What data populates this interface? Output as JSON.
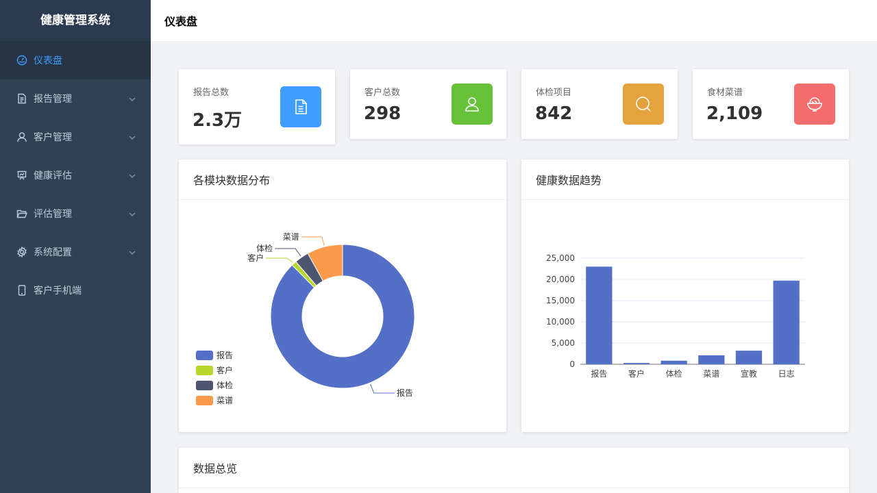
{
  "app": {
    "title": "健康管理系统"
  },
  "header": {
    "title": "仪表盘"
  },
  "sidebar": {
    "items": [
      {
        "label": "仪表盘",
        "icon": "dashboard-icon",
        "active": true,
        "expandable": false
      },
      {
        "label": "报告管理",
        "icon": "document-icon",
        "active": false,
        "expandable": true
      },
      {
        "label": "客户管理",
        "icon": "user-icon",
        "active": false,
        "expandable": true
      },
      {
        "label": "健康评估",
        "icon": "presentation-icon",
        "active": false,
        "expandable": true
      },
      {
        "label": "评估管理",
        "icon": "folder-open-icon",
        "active": false,
        "expandable": true
      },
      {
        "label": "系统配置",
        "icon": "gear-icon",
        "active": false,
        "expandable": true
      },
      {
        "label": "客户手机端",
        "icon": "mobile-icon",
        "active": false,
        "expandable": false
      }
    ]
  },
  "stats": [
    {
      "label": "报告总数",
      "value": "2.3万",
      "icon": "document-icon",
      "color": "#409eff"
    },
    {
      "label": "客户总数",
      "value": "298",
      "icon": "user-icon",
      "color": "#67c23a"
    },
    {
      "label": "体检项目",
      "value": "842",
      "icon": "search-icon",
      "color": "#e6a23c"
    },
    {
      "label": "食材菜谱",
      "value": "2,109",
      "icon": "food-bowl-icon",
      "color": "#f56c6c"
    }
  ],
  "panels": {
    "distribution": {
      "title": "各模块数据分布"
    },
    "trend": {
      "title": "健康数据趋势"
    },
    "overview": {
      "title": "数据总览"
    }
  },
  "chart_data": [
    {
      "type": "pie",
      "variant": "donut",
      "labels": [
        "报告",
        "客户",
        "体检",
        "菜谱"
      ],
      "values": [
        23000,
        298,
        842,
        2109
      ],
      "colors": [
        "#5470c6",
        "#b8d62b",
        "#4e5570",
        "#fc9a4b"
      ],
      "legend": "bottom-left"
    },
    {
      "type": "bar",
      "categories": [
        "报告",
        "客户",
        "体检",
        "菜谱",
        "宣教",
        "日志"
      ],
      "values": [
        23000,
        298,
        842,
        2109,
        3200,
        19700
      ],
      "ylim": [
        0,
        25000
      ],
      "yticks": [
        "25,000",
        "20,000",
        "15,000",
        "10,000",
        "5,000",
        "0"
      ],
      "color": "#5470c6",
      "grid": true
    }
  ]
}
